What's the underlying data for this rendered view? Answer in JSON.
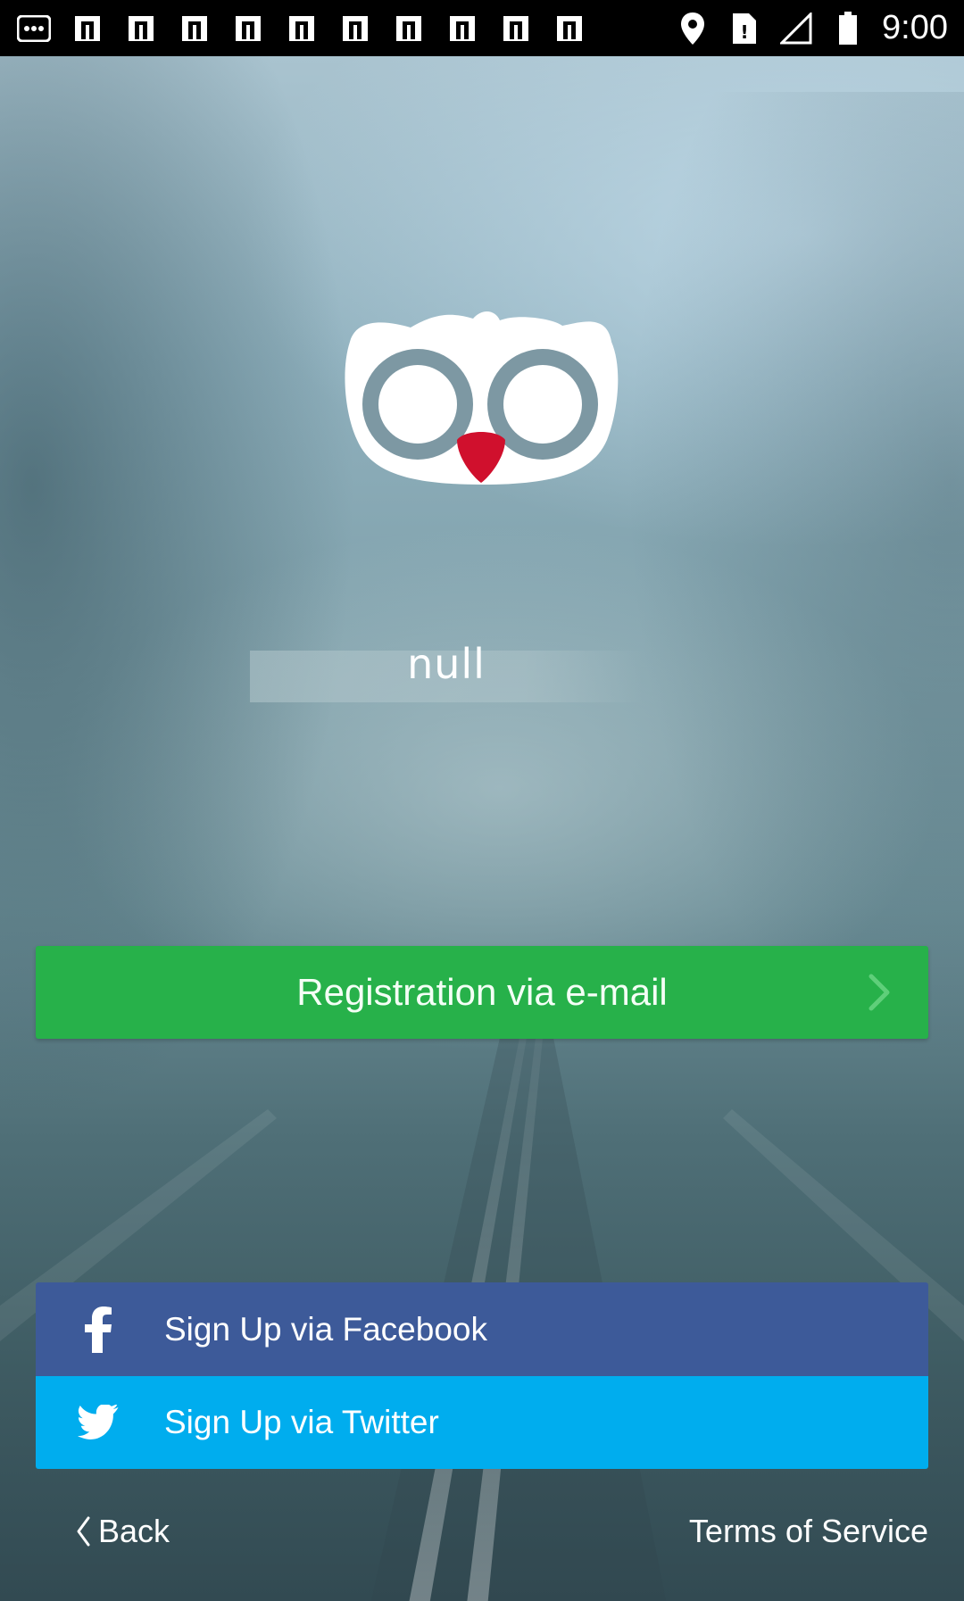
{
  "status_bar": {
    "time": "9:00",
    "left_icons": [
      "more-icon",
      "notification-icon",
      "notification-icon",
      "notification-icon",
      "notification-icon",
      "notification-icon",
      "notification-icon",
      "notification-icon",
      "notification-icon",
      "notification-icon",
      "notification-icon"
    ],
    "right_icons": [
      "location-icon",
      "no-sim-icon",
      "signal-icon",
      "battery-icon"
    ]
  },
  "main": {
    "username_value": "null"
  },
  "buttons": {
    "email_label": "Registration via e-mail",
    "facebook_label": "Sign Up via Facebook",
    "twitter_label": "Sign Up via Twitter"
  },
  "footer": {
    "back_label": "Back",
    "terms_label": "Terms of Service"
  },
  "colors": {
    "email_green": "#27b14a",
    "facebook_blue": "#3d5a99",
    "twitter_blue": "#00adee",
    "owl_beak": "#d0102d"
  }
}
